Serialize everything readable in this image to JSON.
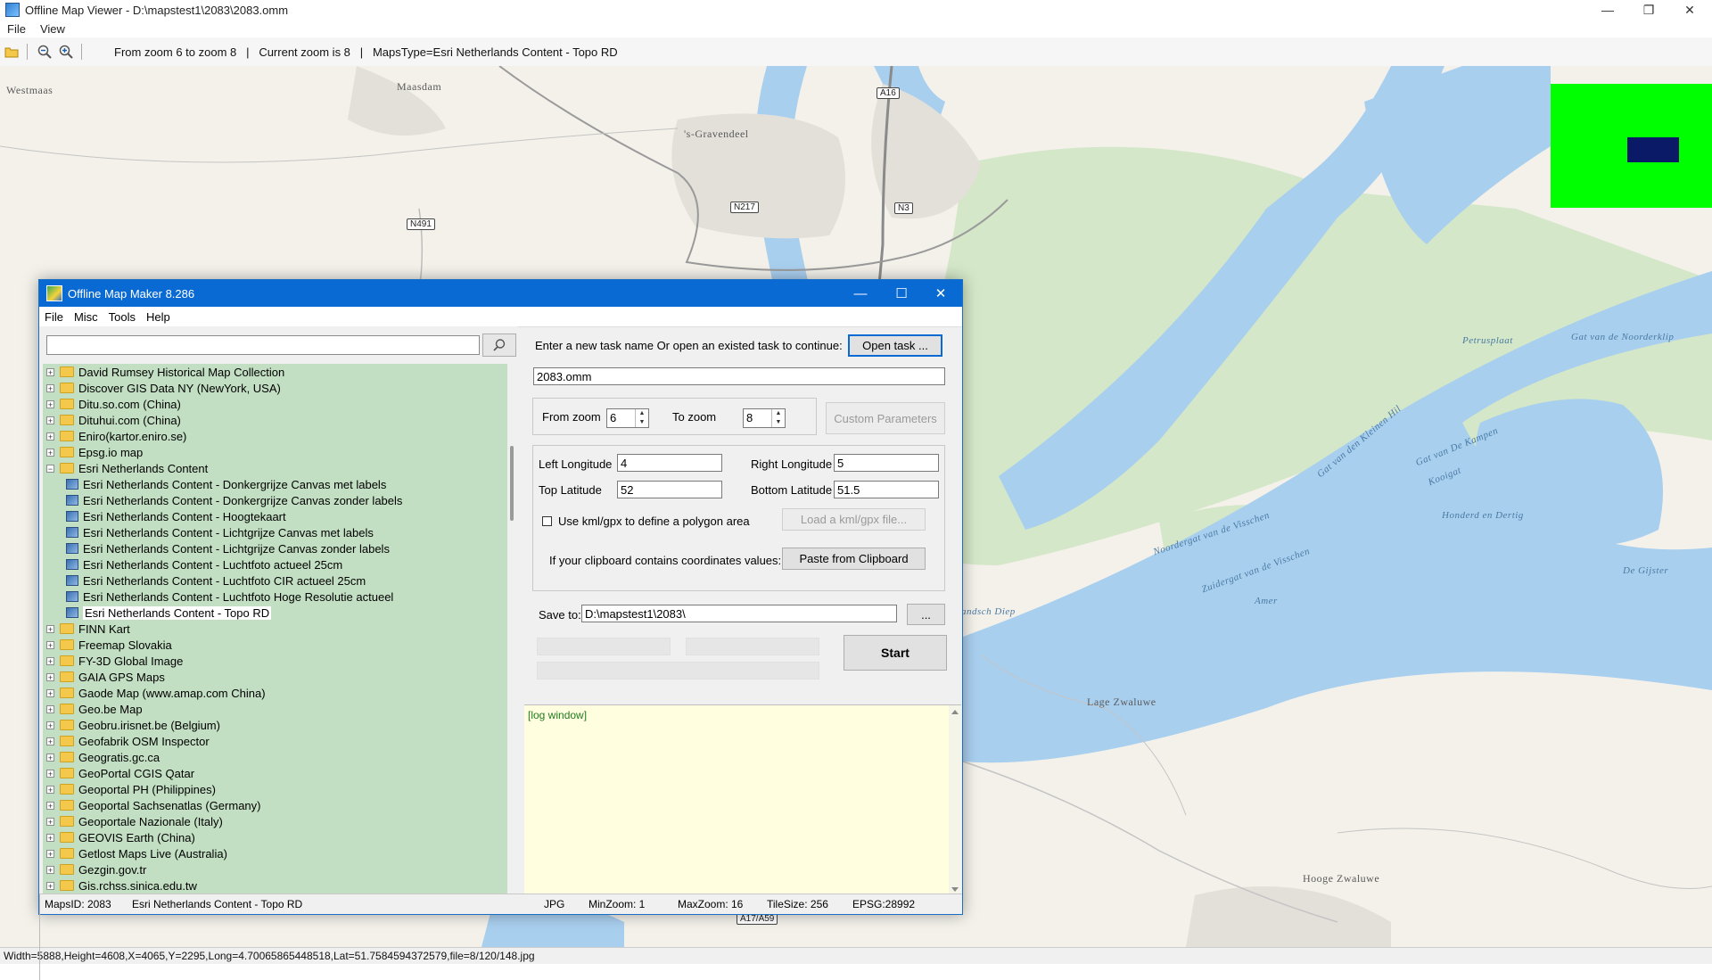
{
  "viewer": {
    "title": "Offline Map Viewer - D:\\mapstest1\\2083\\2083.omm",
    "menu": [
      "File",
      "View"
    ],
    "toolbar_info": "From zoom 6 to zoom 8   |   Current zoom is 8   |   MapsType=Esri Netherlands Content - Topo RD",
    "status": "Width=5888,Height=4608,X=4065,Y=2295,Long=4.70065865448518,Lat=51.7584594372579,file=8/120/148.jpg",
    "window_controls": [
      "—",
      "❐",
      "✕"
    ],
    "icons": [
      "open-folder-icon",
      "zoom-out-icon",
      "zoom-in-icon"
    ]
  },
  "map": {
    "labels": [
      "Westmaas",
      "Maasdam",
      "'s-Gravendeel",
      "Lage Zwaluwe",
      "Hooge Zwaluwe",
      "Amer"
    ],
    "water_labels": [
      "Petrusplaat",
      "Gat van de Noorderklip",
      "Gat van den Kleinen Hil",
      "Gat van De Kampen",
      "Kooigat",
      "Honderd en Dertig",
      "De Gijster",
      "Noordergat van de Visschen",
      "Zuidergat van de Visschen",
      "andsch Diep"
    ],
    "road_shields": [
      "A16",
      "N217",
      "N3",
      "N491",
      "A17/A59"
    ],
    "colors": {
      "land": "#f3f1ea",
      "water": "#a9cfef",
      "green": "#cde3c3",
      "minimap": "#00ff00",
      "minimap_view": "#0b1a66"
    }
  },
  "dialog": {
    "title": "Offline Map Maker 8.286",
    "menu": [
      "File",
      "Misc",
      "Tools",
      "Help"
    ],
    "search": {
      "value": "",
      "icon": "search-icon"
    },
    "tree": [
      {
        "label": "David Rumsey Historical Map Collection",
        "level": 0,
        "expanded": false
      },
      {
        "label": "Discover GIS Data NY (NewYork, USA)",
        "level": 0,
        "expanded": false
      },
      {
        "label": "Ditu.so.com (China)",
        "level": 0,
        "expanded": false
      },
      {
        "label": "Dituhui.com (China)",
        "level": 0,
        "expanded": false
      },
      {
        "label": "Eniro(kartor.eniro.se)",
        "level": 0,
        "expanded": false
      },
      {
        "label": "Epsg.io map",
        "level": 0,
        "expanded": false
      },
      {
        "label": "Esri Netherlands Content",
        "level": 0,
        "expanded": true
      },
      {
        "label": "Esri Netherlands Content - Donkergrijze Canvas met labels",
        "level": 1
      },
      {
        "label": "Esri Netherlands Content - Donkergrijze Canvas zonder labels",
        "level": 1
      },
      {
        "label": "Esri Netherlands Content - Hoogtekaart",
        "level": 1
      },
      {
        "label": "Esri Netherlands Content - Lichtgrijze Canvas met labels",
        "level": 1
      },
      {
        "label": "Esri Netherlands Content - Lichtgrijze Canvas zonder labels",
        "level": 1
      },
      {
        "label": "Esri Netherlands Content - Luchtfoto actueel 25cm",
        "level": 1
      },
      {
        "label": "Esri Netherlands Content - Luchtfoto CIR actueel 25cm",
        "level": 1
      },
      {
        "label": "Esri Netherlands Content - Luchtfoto Hoge Resolutie actueel",
        "level": 1
      },
      {
        "label": "Esri Netherlands Content - Topo RD",
        "level": 1,
        "selected": true
      },
      {
        "label": "FINN Kart",
        "level": 0,
        "expanded": false
      },
      {
        "label": "Freemap Slovakia",
        "level": 0,
        "expanded": false
      },
      {
        "label": "FY-3D Global Image",
        "level": 0,
        "expanded": false
      },
      {
        "label": "GAIA GPS Maps",
        "level": 0,
        "expanded": false
      },
      {
        "label": "Gaode Map (www.amap.com China)",
        "level": 0,
        "expanded": false
      },
      {
        "label": "Geo.be Map",
        "level": 0,
        "expanded": false
      },
      {
        "label": "Geobru.irisnet.be (Belgium)",
        "level": 0,
        "expanded": false
      },
      {
        "label": "Geofabrik OSM Inspector",
        "level": 0,
        "expanded": false
      },
      {
        "label": "Geogratis.gc.ca",
        "level": 0,
        "expanded": false
      },
      {
        "label": "GeoPortal CGIS Qatar",
        "level": 0,
        "expanded": false
      },
      {
        "label": "Geoportal PH (Philippines)",
        "level": 0,
        "expanded": false
      },
      {
        "label": "Geoportal Sachsenatlas (Germany)",
        "level": 0,
        "expanded": false
      },
      {
        "label": "Geoportale Nazionale (Italy)",
        "level": 0,
        "expanded": false
      },
      {
        "label": "GEOVIS Earth (China)",
        "level": 0,
        "expanded": false
      },
      {
        "label": "Getlost Maps Live (Australia)",
        "level": 0,
        "expanded": false
      },
      {
        "label": "Gezgin.gov.tr",
        "level": 0,
        "expanded": false
      },
      {
        "label": "Gis.rchss.sinica.edu.tw",
        "level": 0,
        "expanded": false
      }
    ],
    "task_prompt": "Enter a new task name Or open an existed task to continue:",
    "open_task_label": "Open task ...",
    "task_name": "2083.omm",
    "from_zoom_label": "From zoom",
    "from_zoom": "6",
    "to_zoom_label": "To zoom",
    "to_zoom": "8",
    "custom_params_label": "Custom Parameters",
    "left_lon_label": "Left Longitude",
    "left_lon": "4",
    "right_lon_label": "Right Longitude",
    "right_lon": "5",
    "top_lat_label": "Top Latitude",
    "top_lat": "52",
    "bottom_lat_label": "Bottom Latitude",
    "bottom_lat": "51.5",
    "kml_label": "Use kml/gpx to define a polygon area",
    "kml_checked": false,
    "load_kml_label": "Load a kml/gpx file...",
    "clipboard_prompt": "If your clipboard contains coordinates values:",
    "paste_label": "Paste from Clipboard",
    "save_to_label": "Save to:",
    "save_to": "D:\\mapstest1\\2083\\",
    "browse_label": "...",
    "start_label": "Start",
    "log_text": "[log window]",
    "status": {
      "maps_id": "MapsID: 2083",
      "maps_name": "Esri Netherlands Content - Topo RD",
      "format": "JPG",
      "min_zoom": "MinZoom: 1",
      "max_zoom": "MaxZoom: 16",
      "tile_size": "TileSize: 256",
      "epsg": "EPSG:28992"
    }
  }
}
